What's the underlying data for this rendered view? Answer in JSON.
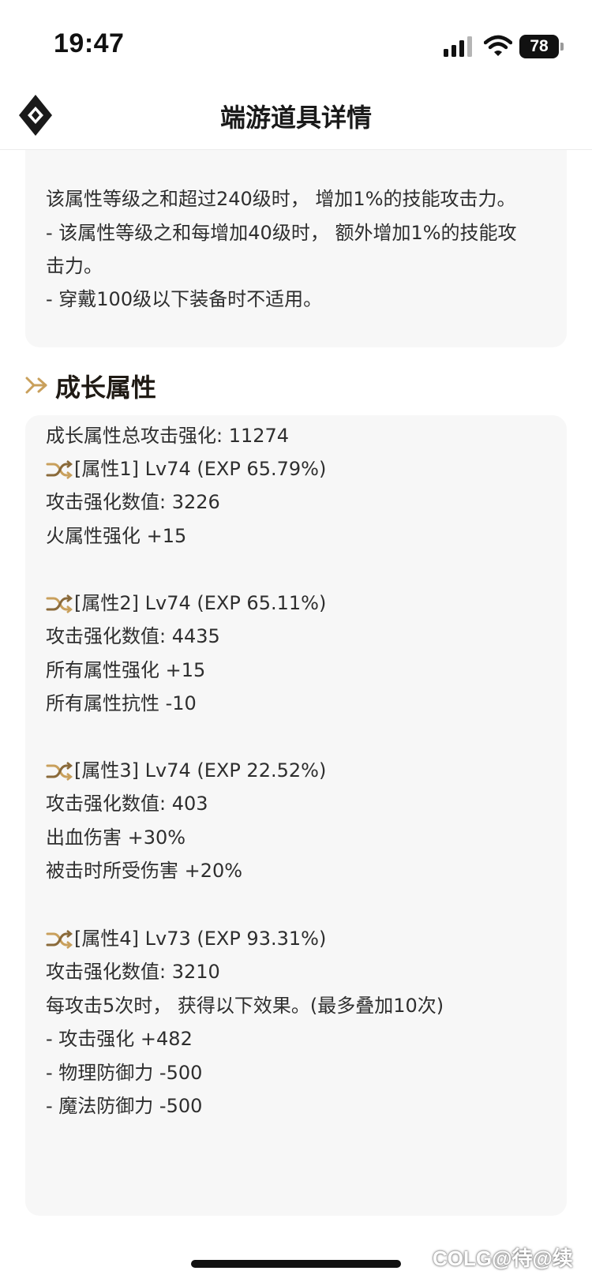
{
  "status_bar": {
    "time": "19:47",
    "battery": "78",
    "icons": [
      "signal-icon",
      "wifi-icon",
      "battery-icon"
    ]
  },
  "header": {
    "title": "端游道具详情",
    "logo_icon": "diamond-logo-icon"
  },
  "intro_card": {
    "lines": [
      "该属性等级之和超过240级时， 增加1%的技能攻击力。",
      "- 该属性等级之和每增加40级时， 额外增加1%的技能攻",
      "击力。",
      "- 穿戴100级以下装备时不适用。"
    ]
  },
  "growth_section": {
    "title": "成长属性",
    "title_icon": "double-chevron-right-icon",
    "total": "成长属性总攻击强化: 11274",
    "attributes": [
      {
        "header": "[属性1] Lv74 (EXP 65.79%)",
        "lines": [
          "攻击强化数值:  3226",
          "火属性强化 +15"
        ]
      },
      {
        "header": "[属性2] Lv74 (EXP 65.11%)",
        "lines": [
          "攻击强化数值:  4435",
          "所有属性强化 +15",
          "所有属性抗性 -10"
        ]
      },
      {
        "header": "[属性3] Lv74 (EXP 22.52%)",
        "lines": [
          "攻击强化数值:  403",
          "出血伤害 +30%",
          "被击时所受伤害 +20%"
        ]
      },
      {
        "header": "[属性4] Lv73 (EXP 93.31%)",
        "lines": [
          "攻击强化数值:  3210",
          "每攻击5次时， 获得以下效果。(最多叠加10次)",
          "- 攻击强化 +482",
          "- 物理防御力 -500",
          "- 魔法防御力 -500"
        ]
      }
    ]
  },
  "watermark": "COLG@待@续",
  "colors": {
    "accent_gold": "#c9a05c",
    "card_bg": "#f7f7f7",
    "text": "#2e2e2e"
  }
}
